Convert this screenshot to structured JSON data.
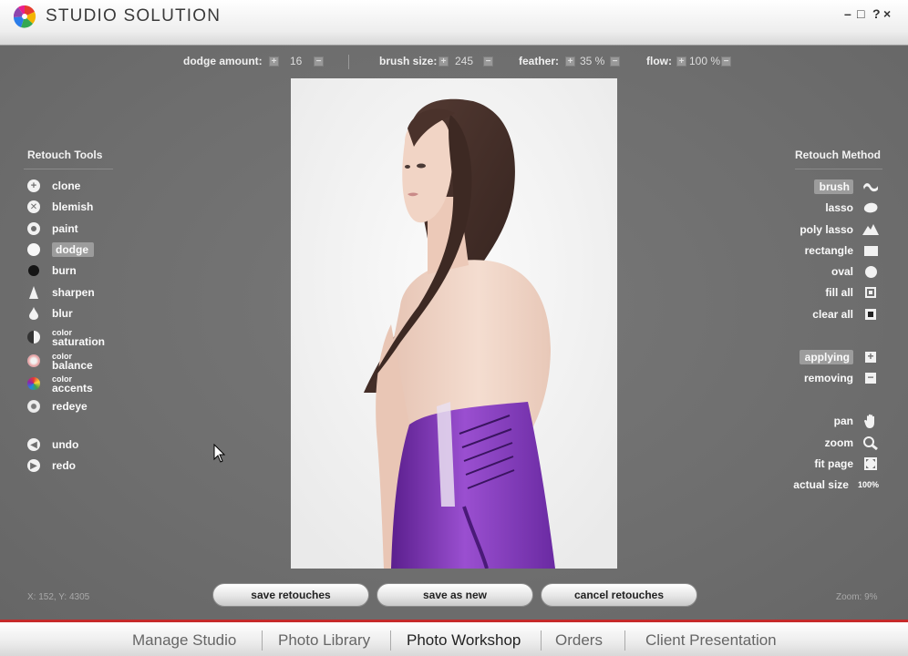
{
  "app": {
    "title": "STUDIO SOLUTION",
    "window_controls": {
      "minimize": "–",
      "maximize": "□",
      "help": "?",
      "close": "×"
    }
  },
  "toolbar": {
    "dodge_amount": {
      "label": "dodge amount:",
      "value": "16",
      "inc": "+",
      "dec": "−"
    },
    "brush_size": {
      "label": "brush size:",
      "value": "245",
      "inc": "+",
      "dec": "−"
    },
    "feather": {
      "label": "feather:",
      "value": "35 %",
      "inc": "+",
      "dec": "−"
    },
    "flow": {
      "label": "flow:",
      "value": "100 %",
      "inc": "+",
      "dec": "−"
    }
  },
  "retouch_tools": {
    "title": "Retouch Tools",
    "items": [
      {
        "label": "clone",
        "icon": "plus-circle-icon"
      },
      {
        "label": "blemish",
        "icon": "x-circle-icon"
      },
      {
        "label": "paint",
        "icon": "ring-icon"
      },
      {
        "label": "dodge",
        "icon": "white-dot-icon",
        "selected": true
      },
      {
        "label": "burn",
        "icon": "black-dot-icon"
      },
      {
        "label": "sharpen",
        "icon": "triangle-icon"
      },
      {
        "label": "blur",
        "icon": "drop-icon"
      },
      {
        "small": "color",
        "label": "saturation",
        "icon": "half-circle-icon"
      },
      {
        "small": "color",
        "label": "balance",
        "icon": "color-balance-icon"
      },
      {
        "small": "color",
        "label": "accents",
        "icon": "color-wheel-icon"
      },
      {
        "label": "redeye",
        "icon": "eye-icon"
      }
    ],
    "history": [
      {
        "label": "undo",
        "icon": "undo-arrow-icon"
      },
      {
        "label": "redo",
        "icon": "redo-arrow-icon"
      }
    ]
  },
  "retouch_methods": {
    "title": "Retouch Method",
    "selection": [
      {
        "label": "brush",
        "icon": "brush-icon",
        "selected": true
      },
      {
        "label": "lasso",
        "icon": "lasso-icon"
      },
      {
        "label": "poly lasso",
        "icon": "poly-lasso-icon"
      },
      {
        "label": "rectangle",
        "icon": "rectangle-icon"
      },
      {
        "label": "oval",
        "icon": "oval-icon"
      },
      {
        "label": "fill all",
        "icon": "fill-all-icon"
      },
      {
        "label": "clear all",
        "icon": "clear-all-icon"
      }
    ],
    "mode": [
      {
        "label": "applying",
        "icon": "plus-square-icon",
        "selected": true
      },
      {
        "label": "removing",
        "icon": "minus-square-icon"
      }
    ],
    "view": [
      {
        "label": "pan",
        "icon": "hand-icon"
      },
      {
        "label": "zoom",
        "icon": "magnifier-icon"
      },
      {
        "label": "fit page",
        "icon": "fit-page-icon"
      },
      {
        "label": "actual size",
        "icon_text": "100%"
      }
    ]
  },
  "actions": {
    "save_retouches": "save retouches",
    "save_as_new": "save as new",
    "cancel_retouches": "cancel retouches"
  },
  "status": {
    "coords": "X: 152, Y: 4305",
    "zoom": "Zoom: 9%"
  },
  "nav": {
    "items": [
      "Manage Studio",
      "Photo Library",
      "Photo Workshop",
      "Orders",
      "Client Presentation"
    ],
    "active": "Photo Workshop"
  },
  "colors": {
    "workspace": "#6f6f6f",
    "accent_red": "#c62a2a",
    "dress_purple": "#7b2fb0"
  }
}
